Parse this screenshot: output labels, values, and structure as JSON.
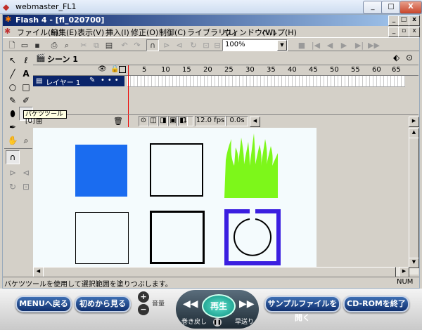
{
  "window": {
    "title": "webmaster_FL1",
    "minimize": "_",
    "maximize": "□",
    "close": "X"
  },
  "app": {
    "title": "Flash 4 - [fl_020700]"
  },
  "menu": [
    "ファイル(F)",
    "編集(E)",
    "表示(V)",
    "挿入(I)",
    "修正(O)",
    "制御(C)",
    "ライブラリ(L)",
    "ウィンドウ(W)",
    "ヘルプ(H)"
  ],
  "toolbar": {
    "zoom": "100%"
  },
  "scene": {
    "label": "シーン 1"
  },
  "timeline": {
    "ruler": [
      "5",
      "10",
      "15",
      "20",
      "25",
      "30",
      "35",
      "40",
      "45",
      "50",
      "55",
      "60",
      "65"
    ],
    "layer_name": "レイヤー 1",
    "frame": "1",
    "fps": "12.0 fps",
    "time": "0.0s"
  },
  "tooltip": "バケツツール [U]",
  "status": {
    "text": "バケツツールを使用して選択範囲を塗りつぶします。",
    "num": "NUM"
  },
  "bottom": {
    "menu_back": "MENUへ戻る",
    "from_start": "初めから見る",
    "volume": "音量",
    "play": "再生",
    "rewind": "巻き戻し",
    "ffwd": "早送り",
    "open_sample": "サンプルファイルを開く",
    "exit_cdrom": "CD-ROMを終了"
  },
  "colors": {
    "blue_fill": "#1a6cf0",
    "green_fill": "#7df71a",
    "purple_stroke": "#3a1ee0"
  }
}
